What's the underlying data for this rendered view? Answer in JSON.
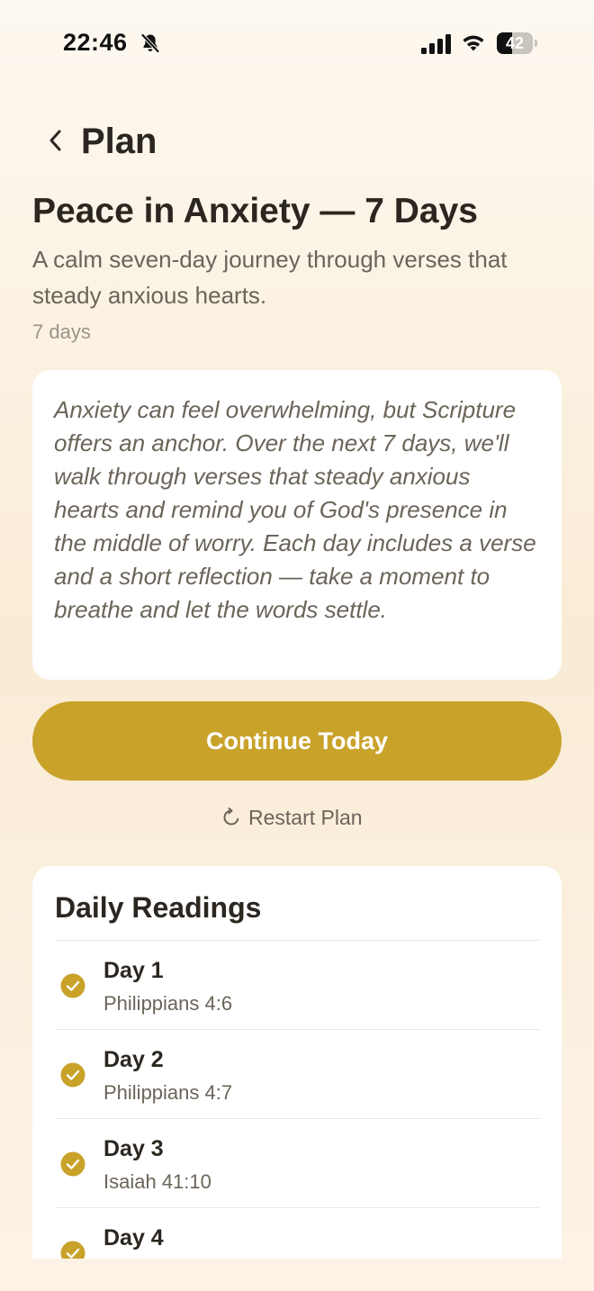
{
  "status_bar": {
    "time": "22:46",
    "battery_level": "42",
    "battery_percent": 42,
    "icons": [
      "bell-off-icon",
      "signal-icon",
      "wifi-icon",
      "battery-icon"
    ]
  },
  "header": {
    "title": "Plan",
    "back_icon": "chevron-left-icon"
  },
  "plan": {
    "title": "Peace in Anxiety — 7 Days",
    "subtitle": "A calm seven-day journey through verses that steady anxious hearts.",
    "duration": "7 days",
    "intro": "Anxiety can feel overwhelming, but Scripture offers an anchor. Over the next 7 days, we'll walk through verses that steady anxious hearts and remind you of God's presence in the middle of worry. Each day includes a verse and a short reflection — take a moment to breathe and let the words settle."
  },
  "actions": {
    "continue_label": "Continue Today",
    "restart_label": "Restart Plan",
    "restart_icon": "restart-icon"
  },
  "readings": {
    "title": "Daily Readings",
    "items": [
      {
        "day": "Day 1",
        "reference": "Philippians 4:6",
        "completed": true
      },
      {
        "day": "Day 2",
        "reference": "Philippians 4:7",
        "completed": true
      },
      {
        "day": "Day 3",
        "reference": "Isaiah 41:10",
        "completed": true
      },
      {
        "day": "Day 4",
        "reference": "",
        "completed": true
      }
    ]
  },
  "colors": {
    "accent": "#c9a22a",
    "text_primary": "#2b2620",
    "text_secondary": "#6b6459",
    "text_muted": "#9a938a",
    "card_bg": "#ffffff"
  }
}
